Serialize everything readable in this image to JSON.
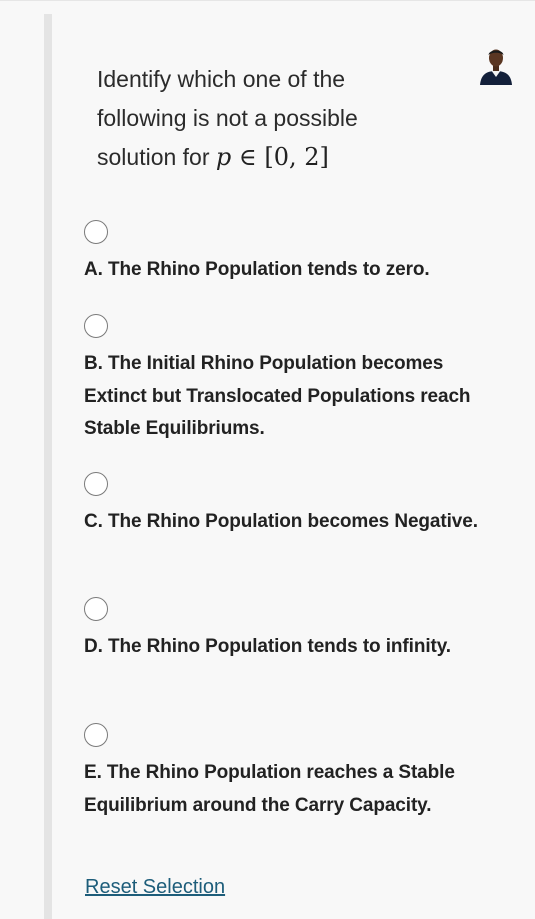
{
  "question": {
    "text": "Identify which one of the following is not a possible solution for",
    "math": {
      "variable": "p",
      "relation": "∈",
      "interval": "[0, 2]"
    }
  },
  "options": [
    {
      "label": "A. The Rhino Population tends to zero.",
      "selected": false
    },
    {
      "label": "B. The Initial Rhino Population becomes Extinct but Translocated Populations reach Stable Equilibriums.",
      "selected": false
    },
    {
      "label": "C. The Rhino Population becomes Negative.",
      "selected": false
    },
    {
      "label": "D. The Rhino Population tends to infinity.",
      "selected": false
    },
    {
      "label": "E. The Rhino Population reaches a Stable Equilibrium around the Carry Capacity.",
      "selected": false
    }
  ],
  "reset_label": "Reset Selection",
  "icons": {
    "avatar": "user-avatar"
  },
  "colors": {
    "link": "#1d5d7a",
    "accent_bar": "#e4e4e4"
  }
}
